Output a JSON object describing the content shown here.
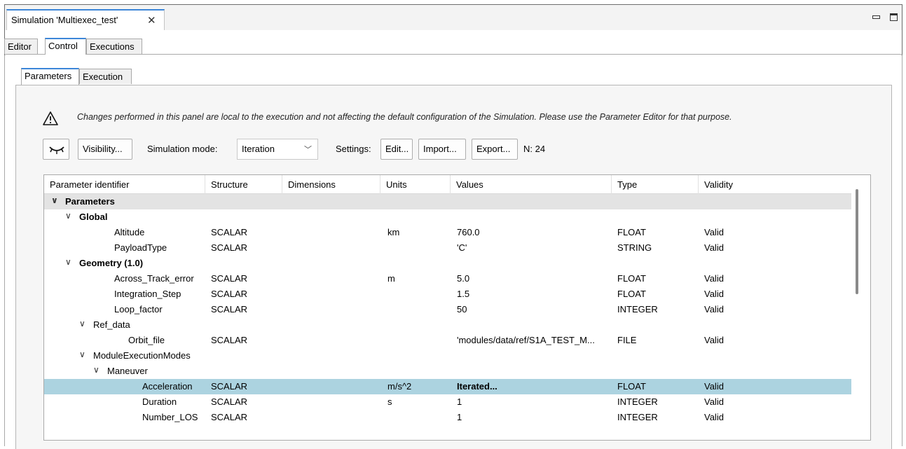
{
  "editor_tab": {
    "title": "Simulation 'Multiexec_test'"
  },
  "top_tabs": [
    "Editor",
    "Control",
    "Executions"
  ],
  "inner_tabs": [
    "Parameters",
    "Execution"
  ],
  "warning": "Changes performed in this panel are local to the execution and not affecting the default configuration of the Simulation. Please use the Parameter Editor for that purpose.",
  "toolbar": {
    "visibility_label": "Visibility...",
    "sim_mode_label": "Simulation mode:",
    "sim_mode_value": "Iteration",
    "settings_label": "Settings:",
    "edit_label": "Edit...",
    "import_label": "Import...",
    "export_label": "Export...",
    "count": "N: 24"
  },
  "table": {
    "columns": [
      "Parameter identifier",
      "Structure",
      "Dimensions",
      "Units",
      "Values",
      "Type",
      "Validity"
    ],
    "rows": [
      {
        "name": "Parameters",
        "structure": "",
        "dimensions": "",
        "units": "",
        "values": "",
        "type": "",
        "validity": ""
      },
      {
        "name": "Global",
        "structure": "",
        "dimensions": "",
        "units": "",
        "values": "",
        "type": "",
        "validity": ""
      },
      {
        "name": "Altitude",
        "structure": "SCALAR",
        "dimensions": "",
        "units": "km",
        "values": "760.0",
        "type": "FLOAT",
        "validity": "Valid"
      },
      {
        "name": "PayloadType",
        "structure": "SCALAR",
        "dimensions": "",
        "units": "",
        "values": "'C'",
        "type": "STRING",
        "validity": "Valid"
      },
      {
        "name": "Geometry (1.0)",
        "structure": "",
        "dimensions": "",
        "units": "",
        "values": "",
        "type": "",
        "validity": ""
      },
      {
        "name": "Across_Track_error",
        "structure": "SCALAR",
        "dimensions": "",
        "units": "m",
        "values": "5.0",
        "type": "FLOAT",
        "validity": "Valid"
      },
      {
        "name": "Integration_Step",
        "structure": "SCALAR",
        "dimensions": "",
        "units": "",
        "values": "1.5",
        "type": "FLOAT",
        "validity": "Valid"
      },
      {
        "name": "Loop_factor",
        "structure": "SCALAR",
        "dimensions": "",
        "units": "",
        "values": "50",
        "type": "INTEGER",
        "validity": "Valid"
      },
      {
        "name": "Ref_data",
        "structure": "",
        "dimensions": "",
        "units": "",
        "values": "",
        "type": "",
        "validity": ""
      },
      {
        "name": "Orbit_file",
        "structure": "SCALAR",
        "dimensions": "",
        "units": "",
        "values": "'modules/data/ref/S1A_TEST_M...",
        "type": "FILE",
        "validity": "Valid"
      },
      {
        "name": "ModuleExecutionModes",
        "structure": "",
        "dimensions": "",
        "units": "",
        "values": "",
        "type": "",
        "validity": ""
      },
      {
        "name": "Maneuver",
        "structure": "",
        "dimensions": "",
        "units": "",
        "values": "",
        "type": "",
        "validity": ""
      },
      {
        "name": "Acceleration",
        "structure": "SCALAR",
        "dimensions": "",
        "units": "m/s^2",
        "values": "Iterated...",
        "type": "FLOAT",
        "validity": "Valid"
      },
      {
        "name": "Duration",
        "structure": "SCALAR",
        "dimensions": "",
        "units": "s",
        "values": "1",
        "type": "INTEGER",
        "validity": "Valid"
      },
      {
        "name": "Number_LOS",
        "structure": "SCALAR",
        "dimensions": "",
        "units": "",
        "values": "1",
        "type": "INTEGER",
        "validity": "Valid"
      }
    ]
  }
}
